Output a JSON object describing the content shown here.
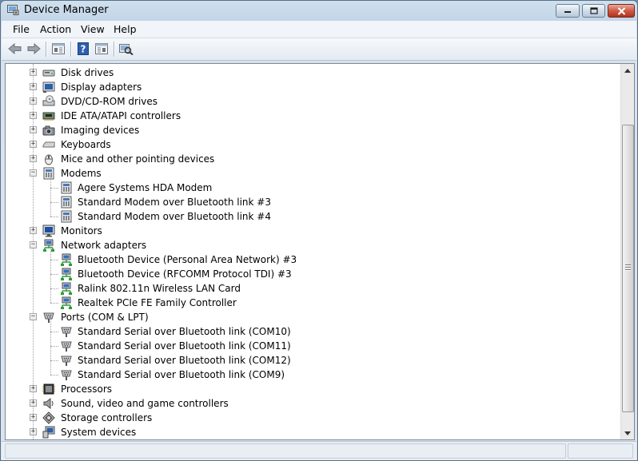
{
  "window": {
    "title": "Device Manager"
  },
  "menu": [
    {
      "label": "File"
    },
    {
      "label": "Action"
    },
    {
      "label": "View"
    },
    {
      "label": "Help"
    }
  ],
  "toolbar": {
    "buttons": [
      "back-icon",
      "forward-icon",
      "properties-icon",
      "help-icon",
      "show-hidden-icon",
      "scan-hardware-icon"
    ]
  },
  "tree": [
    {
      "label": "Disk drives",
      "level": 0,
      "expanded": false,
      "icon": "disk-drive-icon"
    },
    {
      "label": "Display adapters",
      "level": 0,
      "expanded": false,
      "icon": "display-adapter-icon"
    },
    {
      "label": "DVD/CD-ROM drives",
      "level": 0,
      "expanded": false,
      "icon": "dvd-drive-icon"
    },
    {
      "label": "IDE ATA/ATAPI controllers",
      "level": 0,
      "expanded": false,
      "icon": "ide-controller-icon"
    },
    {
      "label": "Imaging devices",
      "level": 0,
      "expanded": false,
      "icon": "camera-icon"
    },
    {
      "label": "Keyboards",
      "level": 0,
      "expanded": false,
      "icon": "keyboard-icon"
    },
    {
      "label": "Mice and other pointing devices",
      "level": 0,
      "expanded": false,
      "icon": "mouse-icon"
    },
    {
      "label": "Modems",
      "level": 0,
      "expanded": true,
      "icon": "modem-icon"
    },
    {
      "label": "Agere Systems HDA Modem",
      "level": 1,
      "icon": "modem-icon"
    },
    {
      "label": "Standard Modem over Bluetooth link #3",
      "level": 1,
      "icon": "modem-icon"
    },
    {
      "label": "Standard Modem over Bluetooth link #4",
      "level": 1,
      "icon": "modem-icon"
    },
    {
      "label": "Monitors",
      "level": 0,
      "expanded": false,
      "icon": "monitor-icon"
    },
    {
      "label": "Network adapters",
      "level": 0,
      "expanded": true,
      "icon": "network-adapter-icon"
    },
    {
      "label": "Bluetooth Device (Personal Area Network) #3",
      "level": 1,
      "icon": "network-adapter-icon"
    },
    {
      "label": "Bluetooth Device (RFCOMM Protocol TDI) #3",
      "level": 1,
      "icon": "network-adapter-icon"
    },
    {
      "label": "Ralink 802.11n Wireless LAN Card",
      "level": 1,
      "icon": "network-adapter-icon"
    },
    {
      "label": "Realtek PCIe FE Family Controller",
      "level": 1,
      "icon": "network-adapter-icon"
    },
    {
      "label": "Ports (COM & LPT)",
      "level": 0,
      "expanded": true,
      "icon": "port-icon"
    },
    {
      "label": "Standard Serial over Bluetooth link (COM10)",
      "level": 1,
      "icon": "port-icon"
    },
    {
      "label": "Standard Serial over Bluetooth link (COM11)",
      "level": 1,
      "icon": "port-icon"
    },
    {
      "label": "Standard Serial over Bluetooth link (COM12)",
      "level": 1,
      "icon": "port-icon"
    },
    {
      "label": "Standard Serial over Bluetooth link (COM9)",
      "level": 1,
      "icon": "port-icon"
    },
    {
      "label": "Processors",
      "level": 0,
      "expanded": false,
      "icon": "processor-icon"
    },
    {
      "label": "Sound, video and game controllers",
      "level": 0,
      "expanded": false,
      "icon": "speaker-icon"
    },
    {
      "label": "Storage controllers",
      "level": 0,
      "expanded": false,
      "icon": "storage-controller-icon"
    },
    {
      "label": "System devices",
      "level": 0,
      "expanded": false,
      "icon": "system-devices-icon"
    }
  ],
  "colors": {
    "titlebar": "#c3d6e8",
    "close_button": "#cf5a45",
    "tree_background": "#ffffff"
  }
}
